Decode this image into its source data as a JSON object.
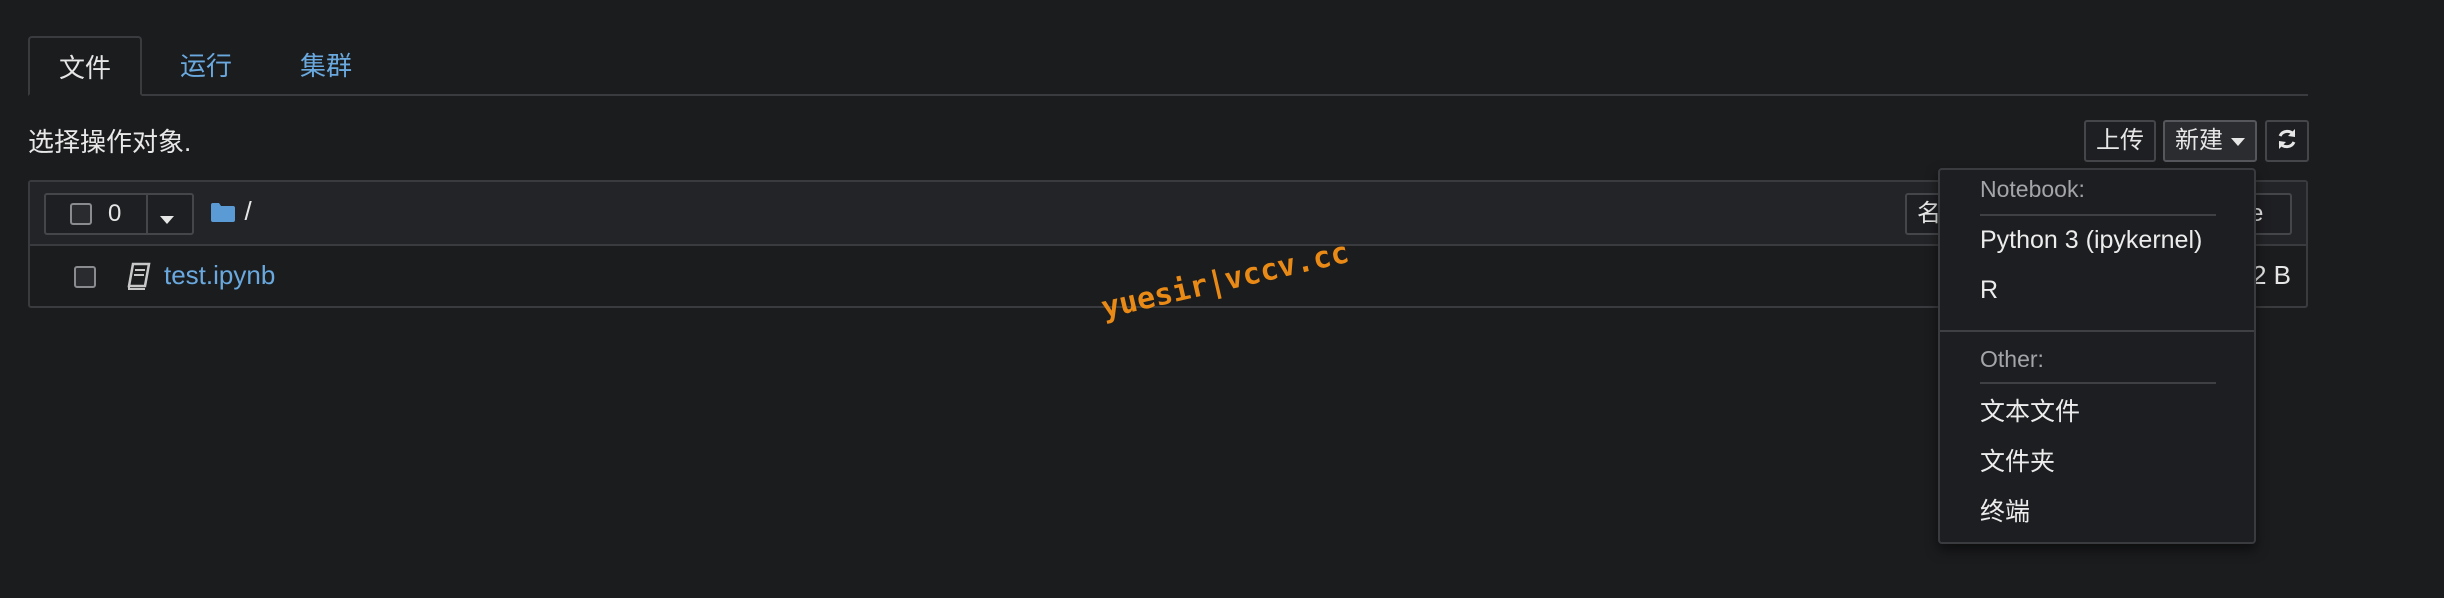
{
  "tabs": [
    {
      "label": "文件",
      "active": true
    },
    {
      "label": "运行",
      "active": false
    },
    {
      "label": "集群",
      "active": false
    }
  ],
  "toolbar": {
    "hint": "选择操作对象.",
    "upload_label": "上传",
    "new_label": "新建",
    "refresh_icon": "refresh-icon"
  },
  "list_header": {
    "selected_count": "0",
    "path": "/",
    "name_col_partial": "名",
    "size_col_partial": "ze"
  },
  "files": [
    {
      "name": "test.ipynb",
      "icon": "notebook-icon",
      "size_partial": "2 B"
    }
  ],
  "new_menu": {
    "notebook_header": "Notebook:",
    "notebook_items": [
      "Python 3 (ipykernel)",
      "R"
    ],
    "other_header": "Other:",
    "other_items": [
      "文本文件",
      "文件夹",
      "终端"
    ]
  },
  "watermark": "yuesir|vccv.cc",
  "colors": {
    "background": "#1b1c1e",
    "link": "#6aa9df",
    "folder": "#5b9bd5",
    "watermark": "#e98a16"
  }
}
